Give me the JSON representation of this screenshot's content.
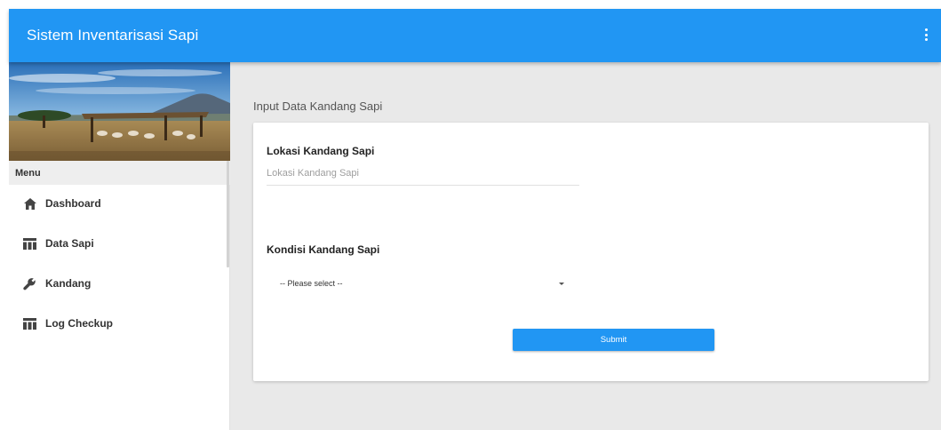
{
  "header": {
    "title": "Sistem Inventarisasi Sapi",
    "menu_icon": "more-vert-icon"
  },
  "sidebar": {
    "menu_heading": "Menu",
    "items": [
      {
        "label": "Dashboard",
        "icon": "home-icon"
      },
      {
        "label": "Data Sapi",
        "icon": "table-icon"
      },
      {
        "label": "Kandang",
        "icon": "wrench-icon"
      },
      {
        "label": "Log Checkup",
        "icon": "table-icon"
      }
    ]
  },
  "main": {
    "page_title": "Input Data Kandang Sapi",
    "form": {
      "location_label": "Lokasi Kandang Sapi",
      "location_placeholder": "Lokasi Kandang Sapi",
      "location_value": "",
      "condition_label": "Kondisi Kandang Sapi",
      "condition_selected": "-- Please select --",
      "submit_label": "Submit"
    }
  },
  "colors": {
    "primary": "#2196f3",
    "main_background": "#e9e9e9",
    "menu_heading_background": "#eeeeee"
  }
}
